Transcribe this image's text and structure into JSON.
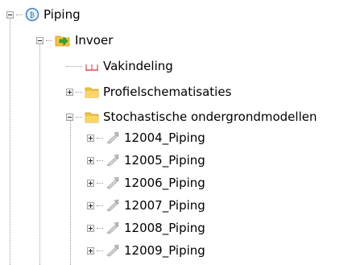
{
  "tree": {
    "root": {
      "label": "Piping",
      "icon": "piping-failure-mechanism-icon",
      "expanded": true
    },
    "invoer": {
      "label": "Invoer",
      "icon": "input-folder-icon",
      "expanded": true
    },
    "vakindeling": {
      "label": "Vakindeling",
      "icon": "section-division-icon"
    },
    "profielschematisaties": {
      "label": "Profielschematisaties",
      "icon": "folder-icon",
      "expanded": false
    },
    "stochastische": {
      "label": "Stochastische ondergrondmodellen",
      "icon": "folder-icon",
      "expanded": true
    },
    "models": [
      {
        "label": "12004_Piping",
        "icon": "soil-model-icon",
        "expanded": false
      },
      {
        "label": "12005_Piping",
        "icon": "soil-model-icon",
        "expanded": false
      },
      {
        "label": "12006_Piping",
        "icon": "soil-model-icon",
        "expanded": false
      },
      {
        "label": "12007_Piping",
        "icon": "soil-model-icon",
        "expanded": false
      },
      {
        "label": "12008_Piping",
        "icon": "soil-model-icon",
        "expanded": false
      },
      {
        "label": "12009_Piping",
        "icon": "soil-model-icon",
        "expanded": false
      }
    ]
  },
  "colors": {
    "folder": "#f2c23c",
    "input_arrow": "#3aa33a",
    "piping_blue": "#3a7fd5",
    "vakindeling_red": "#e05050"
  }
}
